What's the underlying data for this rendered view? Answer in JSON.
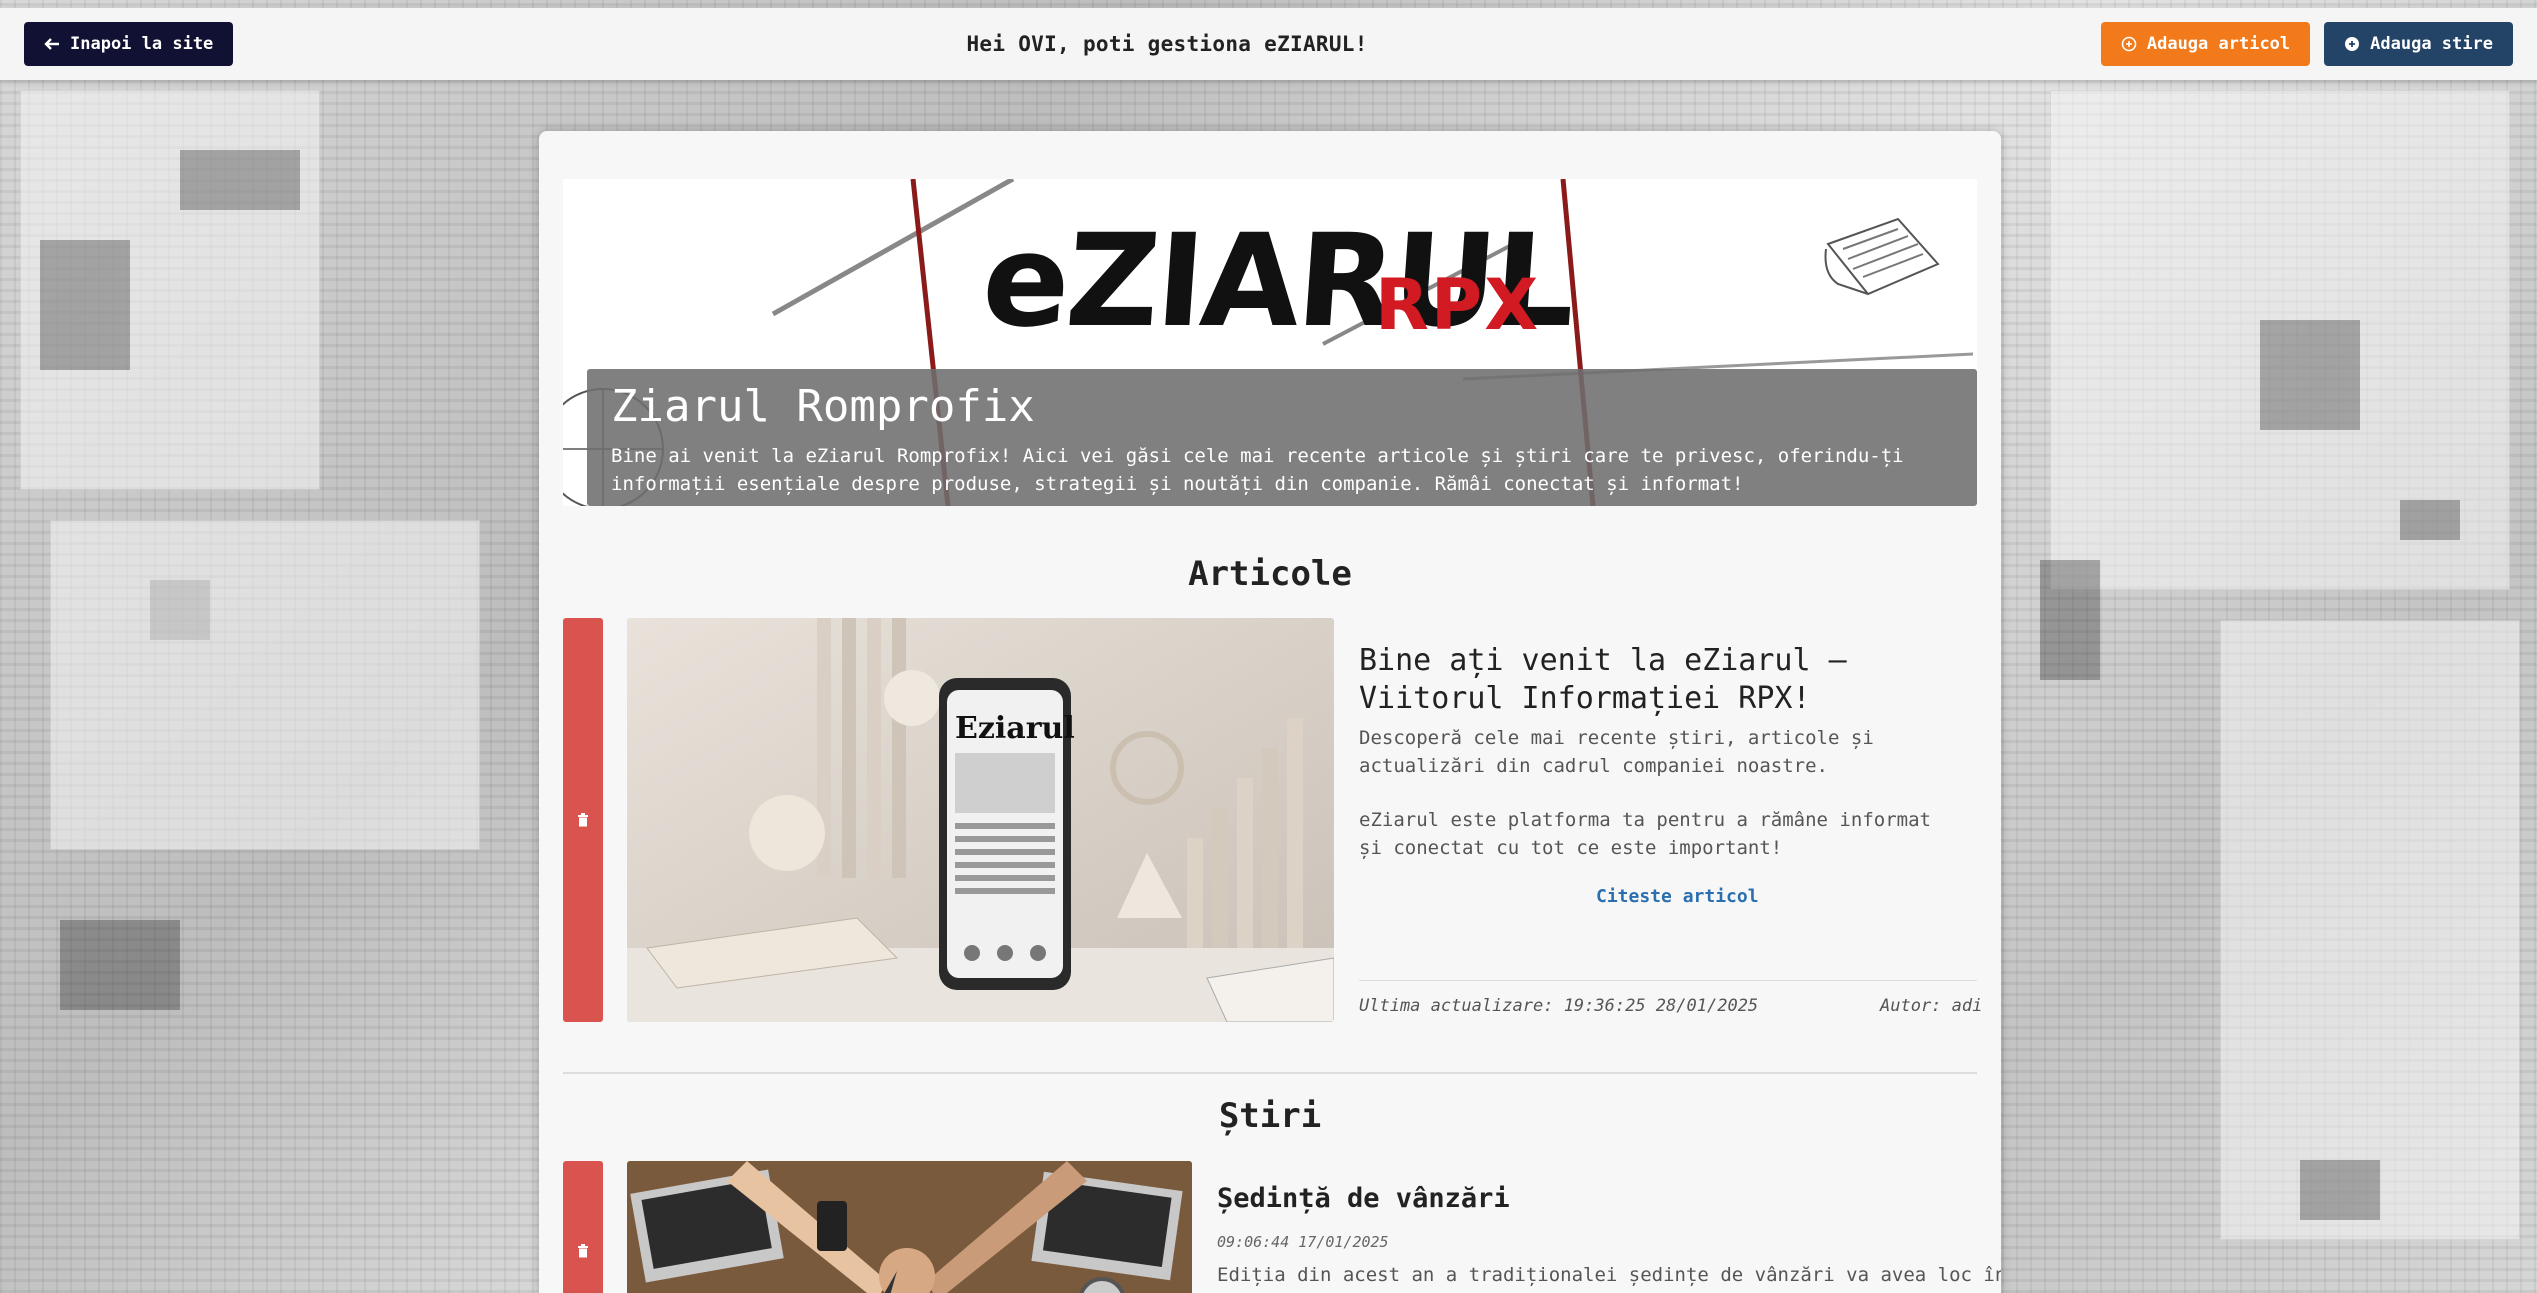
{
  "topbar": {
    "back_label": "Inapoi la site",
    "greeting": "Hei OVI, poti gestiona eZIARUL!",
    "add_article_label": "Adauga articol",
    "add_news_label": "Adauga stire"
  },
  "banner": {
    "logo_text": "eZIARUL",
    "logo_suffix": "RPX",
    "title": "Ziarul Romprofix",
    "description": "Bine ai venit la eZiarul Romprofix! Aici vei găsi cele mai recente articole și știri care te privesc, oferindu-ți informații esențiale despre produse, strategii și noutăți din companie. Rămâi conectat și informat!"
  },
  "articles": {
    "section_title": "Articole",
    "items": [
      {
        "title": "Bine ați venit la eZiarul – Viitorul Informației RPX!",
        "paragraph1": "Descoperă cele mai recente știri, articole și actualizări din cadrul companiei noastre.",
        "paragraph2": "eZiarul este platforma ta pentru a rămâne informat și conectat cu tot ce este important!",
        "read_label": "Citeste articol",
        "updated": "Ultima actualizare: 19:36:25 28/01/2025",
        "author": "Autor: adi",
        "image_text": "Eziarul"
      }
    ]
  },
  "news": {
    "section_title": "Știri",
    "items": [
      {
        "title": "Ședință de vânzări",
        "date": "09:06:44 17/01/2025",
        "text": "Ediția din acest an a tradiționalei ședințe de vânzări va avea loc în perioada"
      }
    ]
  },
  "colors": {
    "delete": "#d9534f",
    "orange": "#f27a1a",
    "navy": "#234466",
    "back": "#111133",
    "link": "#2a6fb0"
  }
}
